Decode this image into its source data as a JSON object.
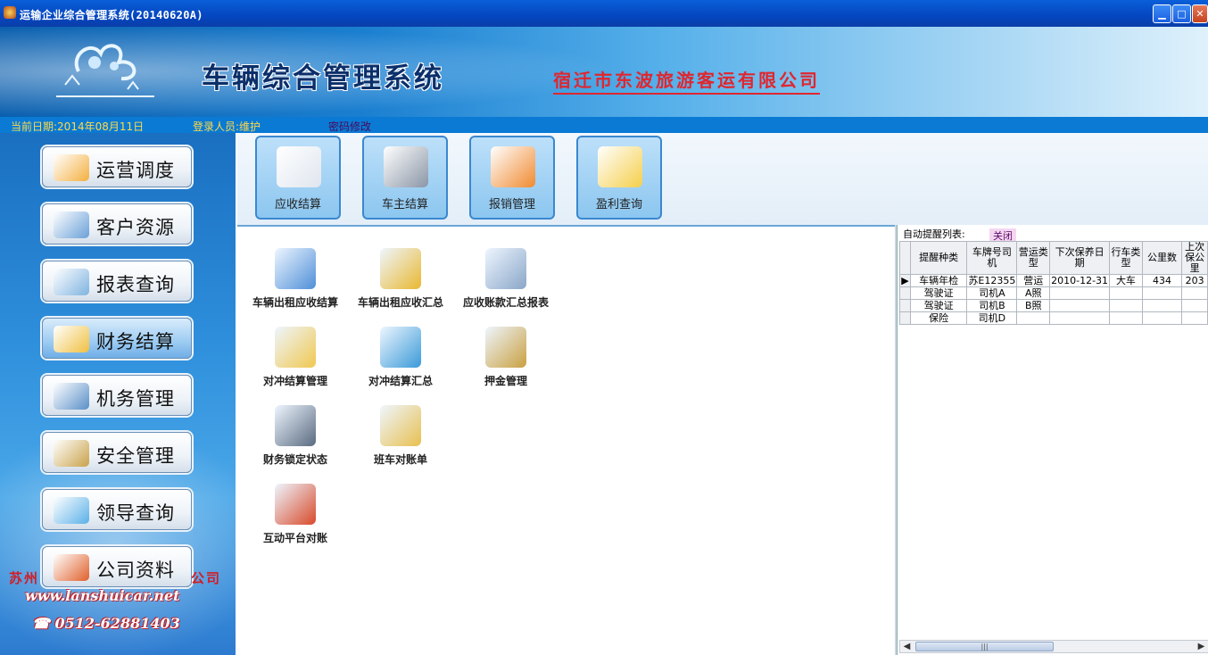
{
  "window": {
    "title": "运输企业综合管理系统(20140620A)",
    "buttons": [
      "minimize",
      "maximize",
      "close"
    ]
  },
  "banner": {
    "system_title": "车辆综合管理系统",
    "company": "宿迁市东波旅游客运有限公司"
  },
  "infobar": {
    "date": "当前日期:2014年08月11日",
    "user": "登录人员:维护",
    "password": "密码修改"
  },
  "sidebar": {
    "items": [
      {
        "label": "运营调度",
        "icon": "truck-icon"
      },
      {
        "label": "客户资源",
        "icon": "contacts-icon"
      },
      {
        "label": "报表查询",
        "icon": "magnifier-report-icon"
      },
      {
        "label": "财务结算",
        "icon": "money-icon",
        "active": true
      },
      {
        "label": "机务管理",
        "icon": "cube-icon"
      },
      {
        "label": "安全管理",
        "icon": "folder-icon"
      },
      {
        "label": "领导查询",
        "icon": "globe-search-icon"
      },
      {
        "label": "公司资料",
        "icon": "briefcase-icon"
      }
    ],
    "company_line": "苏州",
    "company_line_tail": "公司",
    "website": "www.lanshuicar.net",
    "phone": "☎ 0512-62881403"
  },
  "toolbar": {
    "buttons": [
      {
        "label": "应收结算",
        "icon": "calculator-icon"
      },
      {
        "label": "车主结算",
        "icon": "keypad-device-icon"
      },
      {
        "label": "报销管理",
        "icon": "card-file-icon"
      },
      {
        "label": "盈利查询",
        "icon": "profit-chart-icon"
      }
    ]
  },
  "functions": [
    {
      "label": "车辆出租应收结算",
      "icon": "finder-doc-icon"
    },
    {
      "label": "车辆出租应收汇总",
      "icon": "runner-icon"
    },
    {
      "label": "应收账款汇总报表",
      "icon": "computer-icon"
    },
    {
      "label": "对冲结算管理",
      "icon": "chat-person-icon"
    },
    {
      "label": "对冲结算汇总",
      "icon": "globe-monitor-icon"
    },
    {
      "label": "押金管理",
      "icon": "folder-tab-icon"
    },
    {
      "label": "财务锁定状态",
      "icon": "clock-folder-icon"
    },
    {
      "label": "班车对账单",
      "icon": "hammer-folder-icon"
    },
    {
      "label": "互动平台对账",
      "icon": "user-search-icon"
    }
  ],
  "reminders": {
    "title": "自动提醒列表:",
    "close": "关闭",
    "columns": [
      "提醒种类",
      "车牌号司机",
      "营运类型",
      "下次保养日期",
      "行车类型",
      "公里数",
      "上次保公里"
    ],
    "rows": [
      [
        "车辆年检",
        "苏E12355",
        "营运",
        "2010-12-31",
        "大车",
        "434",
        "203"
      ],
      [
        "驾驶证",
        "司机A",
        "A照",
        "",
        "",
        "",
        ""
      ],
      [
        "驾驶证",
        "司机B",
        "B照",
        "",
        "",
        "",
        ""
      ],
      [
        "保险",
        "司机D",
        "",
        "",
        "",
        "",
        ""
      ]
    ]
  },
  "colors": {
    "accent": "#0a7ad4",
    "title_red": "#e0262e",
    "titlebar": "#0446c0"
  }
}
